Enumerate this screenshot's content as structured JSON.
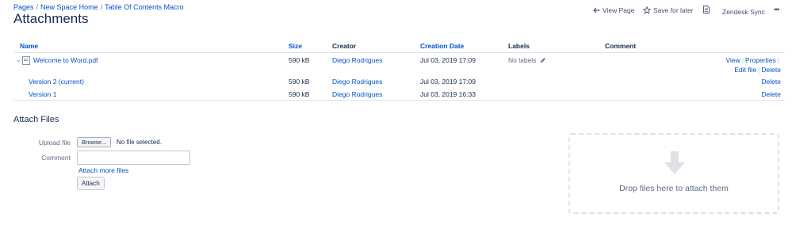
{
  "breadcrumb": {
    "items": [
      "Pages",
      "New Space Home",
      "Table Of Contents Macro"
    ],
    "separator": "/"
  },
  "page_title": "Attachments",
  "page_actions": {
    "view_page": "View Page",
    "save_for_later": "Save for later",
    "zendesk_sync": "Zendesk Sync",
    "more": "•••"
  },
  "table": {
    "headers": {
      "name": "Name",
      "size": "Size",
      "creator": "Creator",
      "creation_date": "Creation Date",
      "labels": "Labels",
      "comment": "Comment"
    },
    "file": {
      "name": "Welcome to Word.pdf",
      "size": "590 kB",
      "creator": "Diego Rodrigues",
      "date": "Jul 03, 2019 17:09",
      "labels": "No labels",
      "actions": {
        "view": "View",
        "properties": "Properties",
        "edit_file": "Edit file",
        "delete": "Delete"
      }
    },
    "versions": [
      {
        "name": "Version 2 (current)",
        "size": "590 kB",
        "creator": "Diego Rodrigues",
        "date": "Jul 03, 2019 17:09",
        "delete": "Delete"
      },
      {
        "name": "Version 1",
        "size": "590 kB",
        "creator": "Diego Rodrigues",
        "date": "Jul 03, 2019 16:33",
        "delete": "Delete"
      }
    ]
  },
  "attach_files": {
    "title": "Attach Files",
    "upload_label": "Upload file",
    "browse": "Browse...",
    "no_file": "No file selected.",
    "comment_label": "Comment",
    "comment_value": "",
    "attach_more": "Attach more files",
    "attach_button": "Attach"
  },
  "dropzone": {
    "text": "Drop files here to attach them"
  },
  "colors": {
    "link": "#0052CC",
    "text": "#172B4D",
    "muted": "#5E6C84",
    "border": "#DFE1E6"
  }
}
